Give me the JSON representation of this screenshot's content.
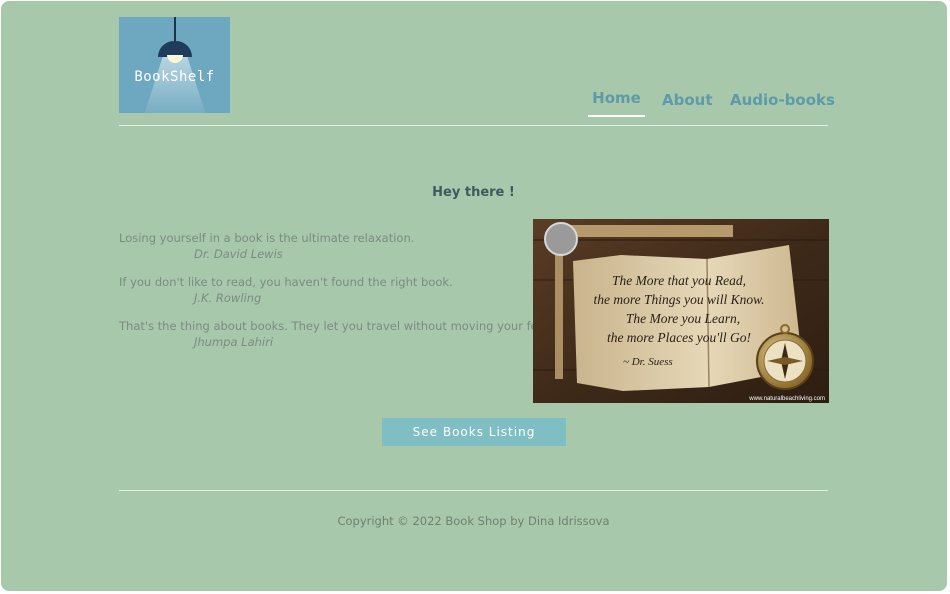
{
  "logo": {
    "name": "BookShelf"
  },
  "nav": {
    "items": [
      {
        "label": "Home",
        "active": true
      },
      {
        "label": "About",
        "active": false
      },
      {
        "label": "Audio-books",
        "active": false
      }
    ]
  },
  "main": {
    "greeting": "Hey there !",
    "quotes": [
      {
        "text": "Losing yourself in a book is the ultimate relaxation.",
        "author": "Dr. David Lewis"
      },
      {
        "text": "If you don't like to read, you haven't found the right book.",
        "author": "J.K. Rowling"
      },
      {
        "text": "That's the thing about books. They let you travel without moving your feet.",
        "author": "Jhumpa Lahiri"
      }
    ],
    "image": {
      "lines": [
        "The More that you Read,",
        "the more Things you will Know.",
        "The More you Learn,",
        "the more Places you'll Go!"
      ],
      "signature": "~ Dr. Suess",
      "watermark": "www.naturalbeachliving.com"
    },
    "cta_label": "See Books Listing"
  },
  "footer": {
    "copyright": "Copyright © 2022 Book Shop by Dina Idrissova"
  },
  "colors": {
    "background": "#a8c8ab",
    "accent": "#5e9aa8",
    "button": "#7fbfc4",
    "logo_bg": "#6ea8c0"
  }
}
